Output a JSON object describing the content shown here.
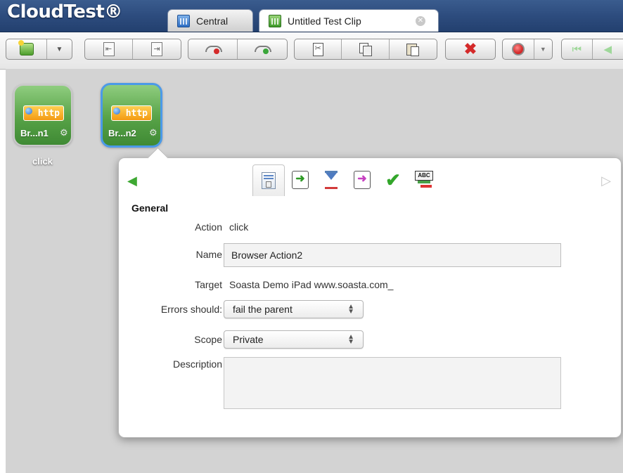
{
  "app": {
    "title": "CloudTest®"
  },
  "tabs": [
    {
      "label": "Central",
      "icon": "grid-icon"
    },
    {
      "label": "Untitled Test Clip",
      "icon": "clip-icon"
    }
  ],
  "toolbar": {
    "icons": [
      "new-item-icon",
      "dropdown-arrow-icon",
      "move-in-icon",
      "move-out-icon",
      "phone-hangup-icon",
      "phone-pickup-icon",
      "cut-icon",
      "copy-icon",
      "paste-icon",
      "delete-icon",
      "record-icon",
      "record-dropdown-icon",
      "first-icon",
      "previous-icon"
    ],
    "delete_color": "#d42a2a",
    "record_color": "#d42a2a"
  },
  "canvas": {
    "nodes": [
      {
        "badge": "http",
        "label": "Br...n1",
        "caption": "click",
        "selected": false
      },
      {
        "badge": "http",
        "label": "Br...n2",
        "caption": "",
        "selected": true
      }
    ],
    "node_color": "#57a247",
    "selection_color": "#4b9ae8"
  },
  "panel": {
    "section": "General",
    "fields": {
      "action_label": "Action",
      "action_value": "click",
      "name_label": "Name",
      "name_value": "Browser Action2",
      "target_label": "Target",
      "target_value": "Soasta Demo iPad www.soasta.com_",
      "errors_label": "Errors should:",
      "errors_value": "fail the parent",
      "scope_label": "Scope",
      "scope_value": "Private",
      "description_label": "Description",
      "description_value": ""
    },
    "tab_icons": [
      "properties-icon",
      "input-icon",
      "wait-icon",
      "output-icon",
      "validation-check-icon",
      "text-validation-icon"
    ],
    "abc_text": "ABC"
  }
}
